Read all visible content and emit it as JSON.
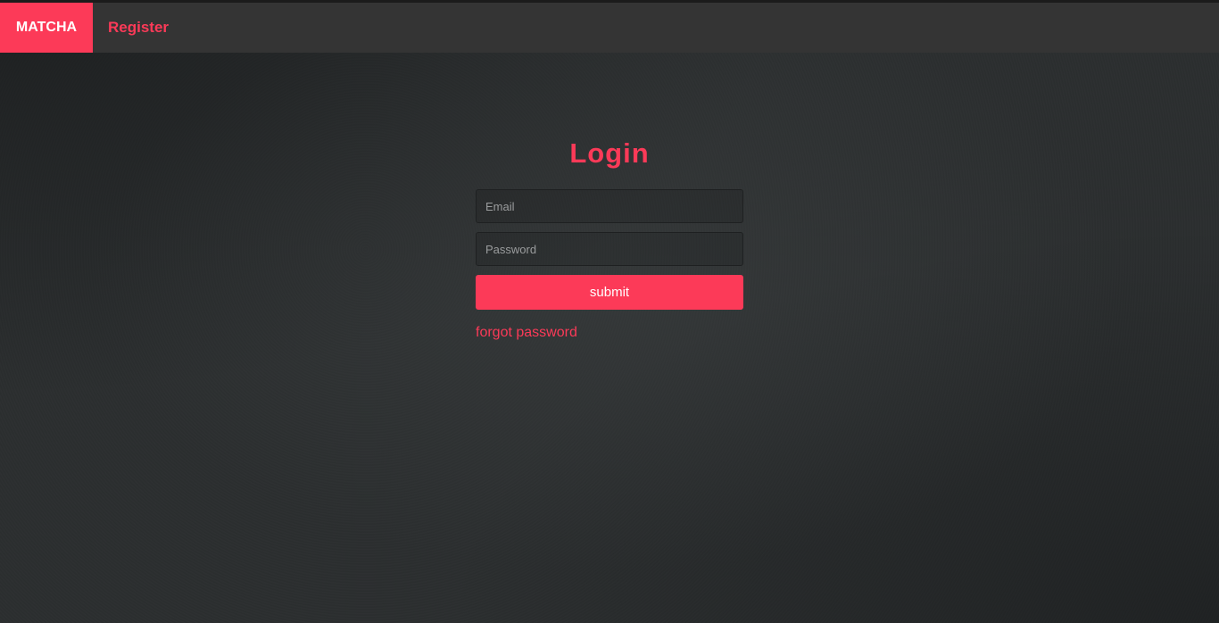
{
  "navbar": {
    "brand": "MATCHA",
    "register_link": "Register"
  },
  "login": {
    "title": "Login",
    "email_placeholder": "Email",
    "email_value": "",
    "password_placeholder": "Password",
    "password_value": "",
    "submit_label": "submit",
    "forgot_link": "forgot password"
  },
  "colors": {
    "accent": "#fc3a58",
    "navbar_bg": "#343434",
    "page_bg": "#2b2e2f"
  }
}
